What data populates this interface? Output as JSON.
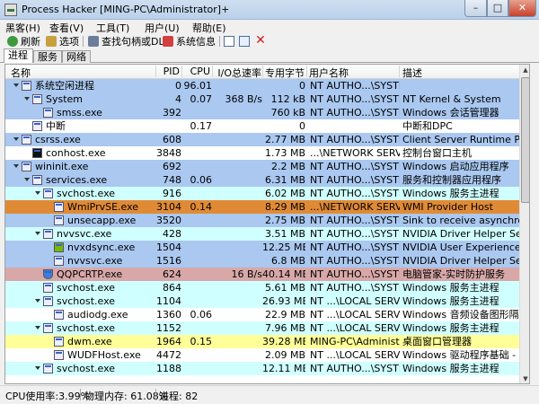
{
  "window": {
    "title": "Process Hacker [MING-PC\\Administrator]+",
    "min_glyph": "–",
    "max_glyph": "□",
    "close_glyph": "✕"
  },
  "menu": [
    "黑客(H)",
    "查看(V)",
    "工具(T)",
    "用户(U)",
    "帮助(E)"
  ],
  "toolbar": {
    "refresh": "刷新",
    "options": "选项",
    "find_handles": "查找句柄或DLL",
    "sysinfo": "系统信息"
  },
  "tabs": [
    "进程",
    "服务",
    "网络"
  ],
  "columns": {
    "name": "名称",
    "pid": "PID",
    "cpu": "CPU",
    "io": "I/O总速率",
    "mem": "专用字节",
    "user": "用户名称",
    "desc": "描述"
  },
  "rows": [
    {
      "name": "系统空闲进程",
      "pid": "0",
      "cpu": "96.01",
      "io": "",
      "mem": "0",
      "user": "NT AUTHO...\\SYSTEM",
      "desc": "",
      "bg": "#aac8f0",
      "depth": 0,
      "toggle": true,
      "icon": "process-icon"
    },
    {
      "name": "System",
      "pid": "4",
      "cpu": "0.07",
      "io": "368 B/s",
      "mem": "112 kB",
      "user": "NT AUTHO...\\SYSTEM",
      "desc": "NT Kernel & System",
      "bg": "#aac8f0",
      "depth": 1,
      "toggle": true,
      "icon": "process-icon"
    },
    {
      "name": "smss.exe",
      "pid": "392",
      "cpu": "",
      "io": "",
      "mem": "760 kB",
      "user": "NT AUTHO...\\SYSTEM",
      "desc": "Windows 会话管理器",
      "bg": "#aac8f0",
      "depth": 2,
      "toggle": false,
      "icon": "process-icon"
    },
    {
      "name": "中断",
      "pid": "",
      "cpu": "0.17",
      "io": "",
      "mem": "0",
      "user": "",
      "desc": "中断和DPC",
      "bg": "#ffffff",
      "depth": 1,
      "toggle": false,
      "icon": "process-icon"
    },
    {
      "name": "csrss.exe",
      "pid": "608",
      "cpu": "",
      "io": "",
      "mem": "2.77 MB",
      "user": "NT AUTHO...\\SYSTEM",
      "desc": "Client Server Runtime Proc...",
      "bg": "#aac8f0",
      "depth": 0,
      "toggle": true,
      "icon": "process-icon"
    },
    {
      "name": "conhost.exe",
      "pid": "3848",
      "cpu": "",
      "io": "",
      "mem": "1.73 MB",
      "user": "...\\NETWORK SERVICE",
      "desc": "控制台窗口主机",
      "bg": "#ffffff",
      "depth": 1,
      "toggle": false,
      "icon": "console-icon"
    },
    {
      "name": "wininit.exe",
      "pid": "692",
      "cpu": "",
      "io": "",
      "mem": "2.2 MB",
      "user": "NT AUTHO...\\SYSTEM",
      "desc": "Windows 启动应用程序",
      "bg": "#aac8f0",
      "depth": 0,
      "toggle": true,
      "icon": "process-icon"
    },
    {
      "name": "services.exe",
      "pid": "748",
      "cpu": "0.06",
      "io": "",
      "mem": "6.31 MB",
      "user": "NT AUTHO...\\SYSTEM",
      "desc": "服务和控制器应用程序",
      "bg": "#aac8f0",
      "depth": 1,
      "toggle": true,
      "icon": "process-icon"
    },
    {
      "name": "svchost.exe",
      "pid": "916",
      "cpu": "",
      "io": "",
      "mem": "6.02 MB",
      "user": "NT AUTHO...\\SYSTEM",
      "desc": "Windows 服务主进程",
      "bg": "#d0ffff",
      "depth": 2,
      "toggle": true,
      "icon": "process-icon"
    },
    {
      "name": "WmiPrvSE.exe",
      "pid": "3104",
      "cpu": "0.14",
      "io": "",
      "mem": "8.29 MB",
      "user": "...\\NETWORK SERVICE",
      "desc": "WMI Provider Host",
      "bg": "#e08a35",
      "depth": 3,
      "toggle": false,
      "icon": "process-icon"
    },
    {
      "name": "unsecapp.exe",
      "pid": "3520",
      "cpu": "",
      "io": "",
      "mem": "2.75 MB",
      "user": "NT AUTHO...\\SYSTEM",
      "desc": "Sink to receive asynchrono...",
      "bg": "#aac8f0",
      "depth": 3,
      "toggle": false,
      "icon": "process-icon"
    },
    {
      "name": "nvvsvc.exe",
      "pid": "428",
      "cpu": "",
      "io": "",
      "mem": "3.51 MB",
      "user": "NT AUTHO...\\SYSTEM",
      "desc": "NVIDIA Driver Helper Servi...",
      "bg": "#d0ffff",
      "depth": 2,
      "toggle": true,
      "icon": "process-icon"
    },
    {
      "name": "nvxdsync.exe",
      "pid": "1504",
      "cpu": "",
      "io": "",
      "mem": "12.25 MB",
      "user": "NT AUTHO...\\SYSTEM",
      "desc": "NVIDIA User Experience Dr...",
      "bg": "#aac8f0",
      "depth": 3,
      "toggle": false,
      "icon": "nvidia-icon"
    },
    {
      "name": "nvvsvc.exe",
      "pid": "1516",
      "cpu": "",
      "io": "",
      "mem": "6.8 MB",
      "user": "NT AUTHO...\\SYSTEM",
      "desc": "NVIDIA Driver Helper Servi...",
      "bg": "#aac8f0",
      "depth": 3,
      "toggle": false,
      "icon": "process-icon"
    },
    {
      "name": "QQPCRTP.exe",
      "pid": "624",
      "cpu": "",
      "io": "16 B/s",
      "mem": "40.14 MB",
      "user": "NT AUTHO...\\SYSTEM",
      "desc": "电脑管家-实时防护服务",
      "bg": "#d8a8a8",
      "depth": 2,
      "toggle": false,
      "icon": "shield-icon"
    },
    {
      "name": "svchost.exe",
      "pid": "864",
      "cpu": "",
      "io": "",
      "mem": "5.61 MB",
      "user": "NT AUTHO...\\SYSTEM",
      "desc": "Windows 服务主进程",
      "bg": "#d0ffff",
      "depth": 2,
      "toggle": false,
      "icon": "process-icon"
    },
    {
      "name": "svchost.exe",
      "pid": "1104",
      "cpu": "",
      "io": "",
      "mem": "26.93 MB",
      "user": "NT ...\\LOCAL SERVICE",
      "desc": "Windows 服务主进程",
      "bg": "#d0ffff",
      "depth": 2,
      "toggle": true,
      "icon": "process-icon"
    },
    {
      "name": "audiodg.exe",
      "pid": "1360",
      "cpu": "0.06",
      "io": "",
      "mem": "22.9 MB",
      "user": "NT ...\\LOCAL SERVICE",
      "desc": "Windows 音频设备图形隔离",
      "bg": "#ffffff",
      "depth": 3,
      "toggle": false,
      "icon": "process-icon"
    },
    {
      "name": "svchost.exe",
      "pid": "1152",
      "cpu": "",
      "io": "",
      "mem": "7.96 MB",
      "user": "NT ...\\LOCAL SERVICE",
      "desc": "Windows 服务主进程",
      "bg": "#d0ffff",
      "depth": 2,
      "toggle": true,
      "icon": "process-icon"
    },
    {
      "name": "dwm.exe",
      "pid": "1964",
      "cpu": "0.15",
      "io": "",
      "mem": "39.28 MB",
      "user": "MING-PC\\Administrat...",
      "desc": "桌面窗口管理器",
      "bg": "#ffff99",
      "depth": 3,
      "toggle": false,
      "icon": "process-icon"
    },
    {
      "name": "WUDFHost.exe",
      "pid": "4472",
      "cpu": "",
      "io": "",
      "mem": "2.09 MB",
      "user": "NT ...\\LOCAL SERVICE",
      "desc": "Windows 驱动程序基础 - 用...",
      "bg": "#ffffff",
      "depth": 3,
      "toggle": false,
      "icon": "process-icon"
    },
    {
      "name": "svchost.exe",
      "pid": "1188",
      "cpu": "",
      "io": "",
      "mem": "12.11 MB",
      "user": "NT AUTHO...\\SYSTEM",
      "desc": "Windows 服务主进程",
      "bg": "#d0ffff",
      "depth": 2,
      "toggle": true,
      "icon": "process-icon"
    }
  ],
  "status": {
    "cpu": "CPU使用率:3.99%",
    "mem": "物理内存: 61.08%",
    "procs": "进程: 82"
  },
  "colors": {
    "service_blue": "#aac8f0",
    "service_cyan": "#d0ffff",
    "selected_orange": "#e08a35",
    "protected_pink": "#d8a8a8",
    "own_process_yellow": "#ffff99"
  }
}
